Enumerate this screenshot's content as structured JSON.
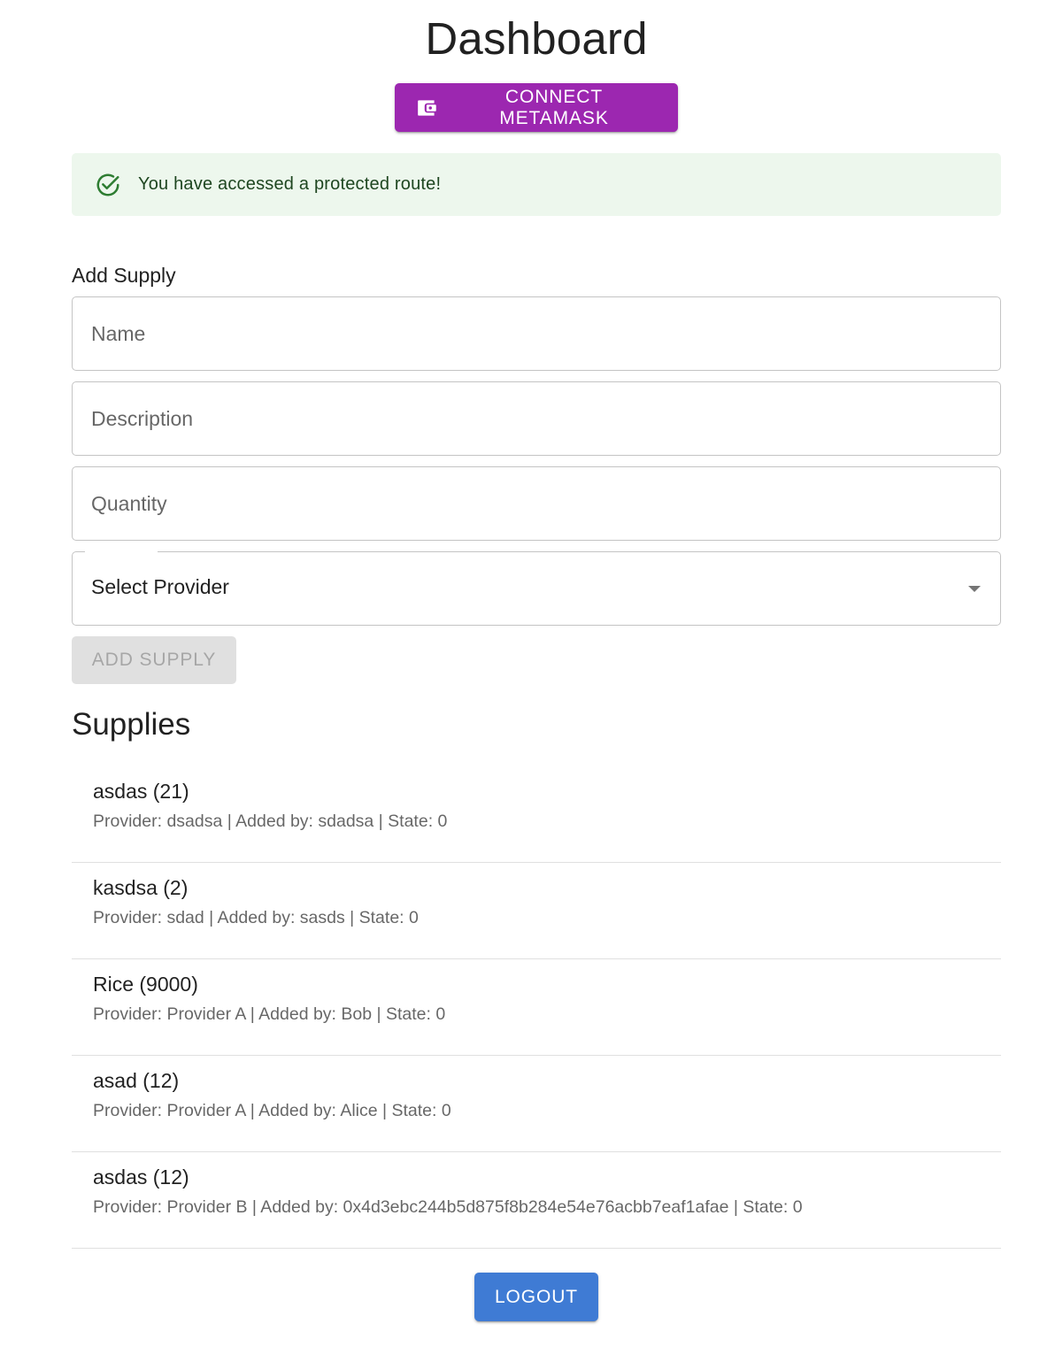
{
  "page": {
    "title": "Dashboard"
  },
  "header": {
    "connect_button_label": "CONNECT METAMASK",
    "connect_button_icon": "wallet-icon",
    "connect_button_color": "#9c27b0"
  },
  "alert": {
    "message": "You have accessed a protected route!",
    "icon": "check-circle-icon",
    "severity": "success",
    "background": "#edf7ed",
    "text_color": "#1e4620"
  },
  "add_supply_form": {
    "heading": "Add Supply",
    "name_field": {
      "placeholder": "Name",
      "value": ""
    },
    "description_field": {
      "placeholder": "Description",
      "value": ""
    },
    "quantity_field": {
      "placeholder": "Quantity",
      "value": ""
    },
    "provider_select": {
      "selected": "Select Provider",
      "icon": "arrow-drop-down-icon"
    },
    "submit_label": "ADD SUPPLY",
    "submit_disabled": true
  },
  "supplies": {
    "heading": "Supplies",
    "items": [
      {
        "primary": "asdas (21)",
        "secondary": "Provider: dsadsa | Added by: sdadsa | State: 0"
      },
      {
        "primary": "kasdsa (2)",
        "secondary": "Provider: sdad | Added by: sasds | State: 0"
      },
      {
        "primary": "Rice (9000)",
        "secondary": "Provider: Provider A | Added by: Bob | State: 0"
      },
      {
        "primary": "asad (12)",
        "secondary": "Provider: Provider A | Added by: Alice | State: 0"
      },
      {
        "primary": "asdas (12)",
        "secondary": "Provider: Provider B | Added by: 0x4d3ebc244b5d875f8b284e54e76acbb7eaf1afae | State: 0"
      }
    ]
  },
  "footer": {
    "logout_label": "LOGOUT",
    "logout_color": "#3f7bd4"
  }
}
